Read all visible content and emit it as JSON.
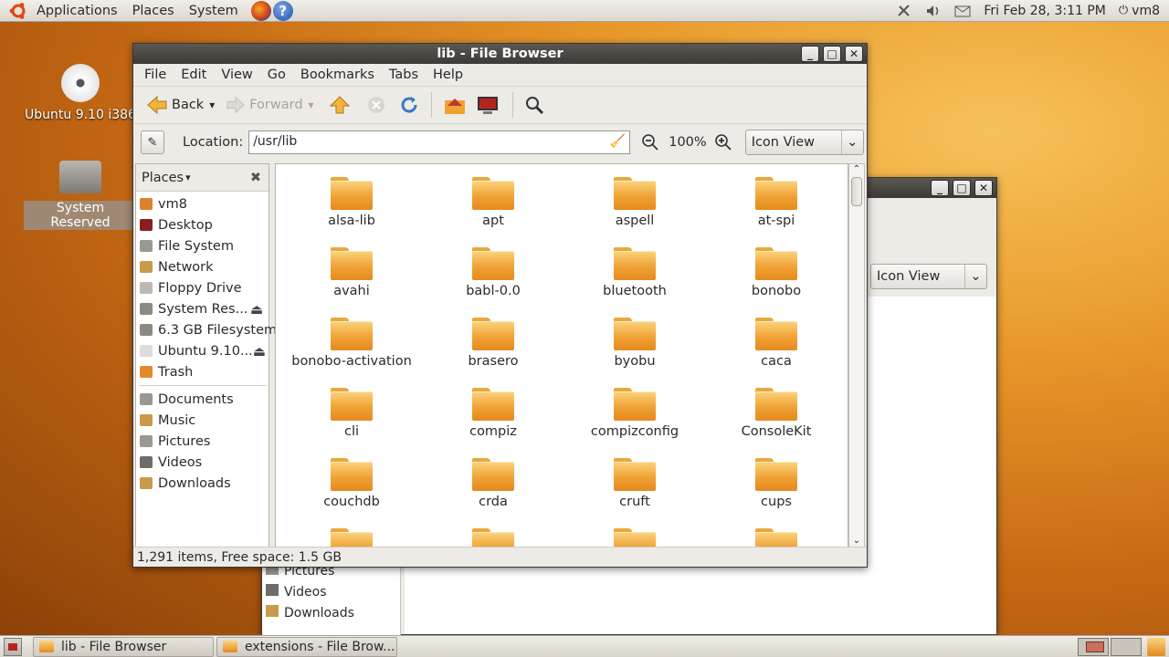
{
  "top_panel": {
    "menus": [
      "Applications",
      "Places",
      "System"
    ],
    "clock": "Fri Feb 28,  3:11 PM",
    "user": "vm8",
    "help_glyph": "?"
  },
  "desktop": {
    "icons": [
      {
        "label": "Ubuntu 9.10 i386",
        "icon": "cd-icon"
      },
      {
        "label": "System Reserved",
        "icon": "drive-icon"
      }
    ]
  },
  "bg_window": {
    "view_mode": "Icon View",
    "sidebar": [
      "Pictures",
      "Videos",
      "Downloads"
    ]
  },
  "window": {
    "title": "lib - File Browser",
    "menu": [
      "File",
      "Edit",
      "View",
      "Go",
      "Bookmarks",
      "Tabs",
      "Help"
    ],
    "toolbar": {
      "back": "Back",
      "forward": "Forward"
    },
    "location_label": "Location:",
    "location_value": "/usr/lib",
    "zoom": "100%",
    "view_mode": "Icon View",
    "sidebar_title": "Places",
    "places": [
      {
        "label": "vm8",
        "color": "#d9822b"
      },
      {
        "label": "Desktop",
        "color": "#8a1f1f"
      },
      {
        "label": "File System",
        "color": "#9a9892"
      },
      {
        "label": "Network",
        "color": "#c89a4a"
      },
      {
        "label": "Floppy Drive",
        "color": "#bdbab3"
      },
      {
        "label": "System Res...",
        "color": "#8d8a84",
        "eject": true
      },
      {
        "label": "6.3 GB Filesystem",
        "color": "#8d8a84"
      },
      {
        "label": "Ubuntu 9.10...",
        "color": "#dcdcdc",
        "eject": true
      },
      {
        "label": "Trash",
        "color": "#e28a2c"
      }
    ],
    "bookmarks": [
      {
        "label": "Documents",
        "color": "#9a9892"
      },
      {
        "label": "Music",
        "color": "#c89a4a"
      },
      {
        "label": "Pictures",
        "color": "#9a9892"
      },
      {
        "label": "Videos",
        "color": "#6f6d68"
      },
      {
        "label": "Downloads",
        "color": "#c89a4a"
      }
    ],
    "files": [
      "alsa-lib",
      "apt",
      "aspell",
      "at-spi",
      "avahi",
      "babl-0.0",
      "bluetooth",
      "bonobo",
      "bonobo-activation",
      "brasero",
      "byobu",
      "caca",
      "cli",
      "compiz",
      "compizconfig",
      "ConsoleKit",
      "couchdb",
      "crda",
      "cruft",
      "cups"
    ],
    "status": "1,291 items, Free space: 1.5 GB"
  },
  "taskbar": {
    "tasks": [
      "lib - File Browser",
      "extensions - File Brow..."
    ]
  }
}
